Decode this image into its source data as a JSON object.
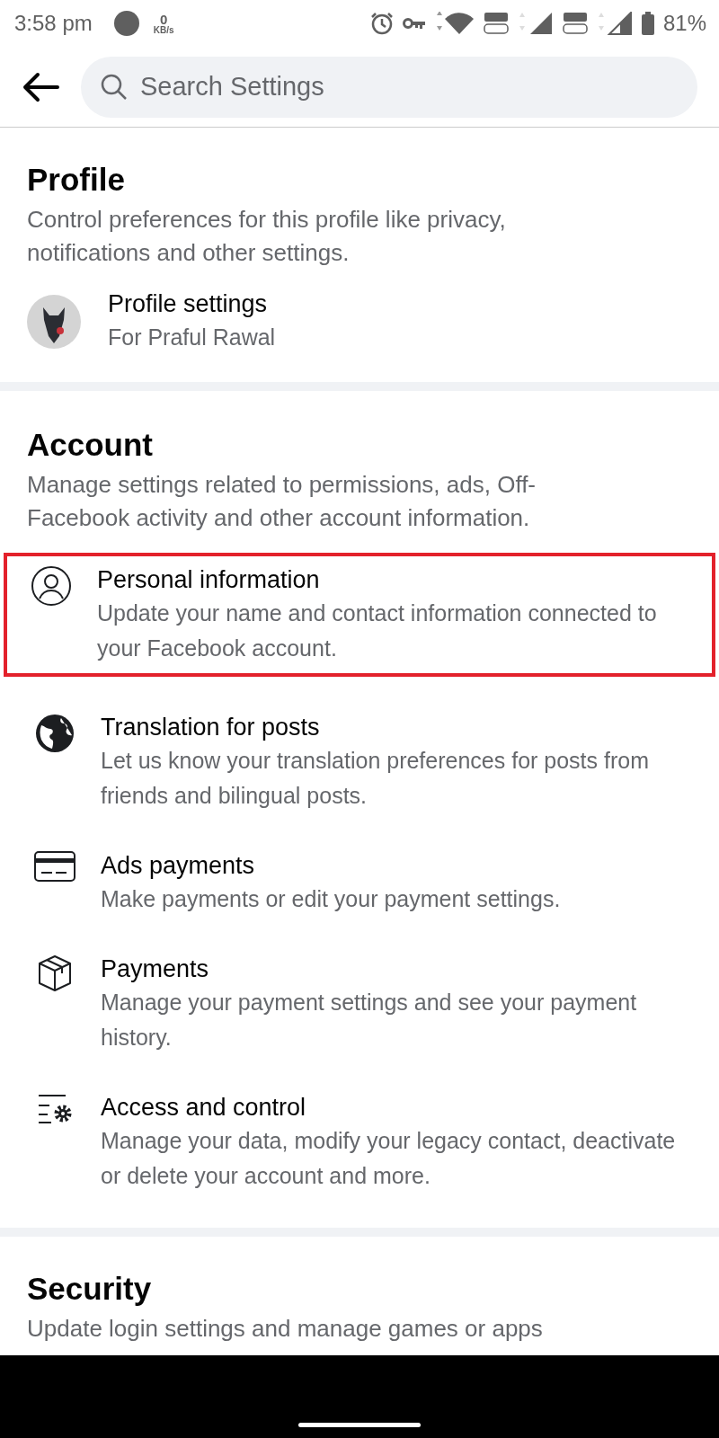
{
  "status_bar": {
    "time": "3:58 pm",
    "speed_value": "0",
    "speed_unit": "KB/s",
    "battery": "81%"
  },
  "search": {
    "placeholder": "Search Settings"
  },
  "profile": {
    "title": "Profile",
    "description": "Control preferences for this profile like privacy, notifications and other settings.",
    "item": {
      "title": "Profile settings",
      "subtitle": "For Praful Rawal"
    }
  },
  "account": {
    "title": "Account",
    "description": "Manage settings related to permissions, ads, Off-Facebook activity and other account information.",
    "items": [
      {
        "kind": "person",
        "title": "Personal information",
        "subtitle": "Update your name and contact information connected to your Facebook account.",
        "highlighted": true
      },
      {
        "kind": "globe",
        "title": "Translation for posts",
        "subtitle": "Let us know your translation preferences for posts from friends and bilingual posts.",
        "highlighted": false
      },
      {
        "kind": "card",
        "title": "Ads payments",
        "subtitle": "Make payments or edit your payment settings.",
        "highlighted": false
      },
      {
        "kind": "box",
        "title": "Payments",
        "subtitle": "Manage your payment settings and see your payment history.",
        "highlighted": false
      },
      {
        "kind": "gear",
        "title": "Access and control",
        "subtitle": "Manage your data, modify your legacy contact, deactivate or delete your account and more.",
        "highlighted": false
      }
    ]
  },
  "security": {
    "title": "Security",
    "description": "Update login settings and manage games or apps"
  }
}
